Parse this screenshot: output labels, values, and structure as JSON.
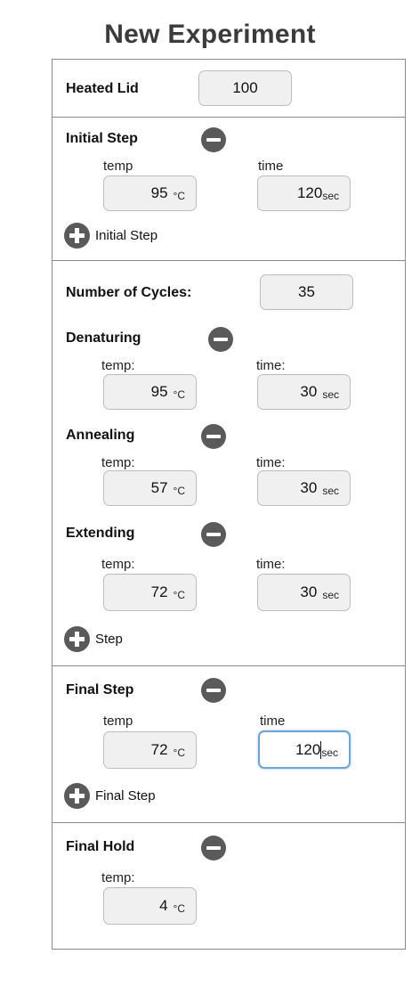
{
  "title": "New Experiment",
  "heated_lid": {
    "label": "Heated Lid",
    "value": "100"
  },
  "initial_step": {
    "label": "Initial Step",
    "temp_label": "temp",
    "time_label": "time",
    "temp": "95",
    "temp_unit": "°C",
    "time": "120",
    "time_unit": "sec",
    "add_label": "Initial Step"
  },
  "cycles": {
    "label": "Number of Cycles:",
    "value": "35",
    "denaturing": {
      "label": "Denaturing",
      "temp_label": "temp:",
      "time_label": "time:",
      "temp": "95",
      "temp_unit": "°C",
      "time": "30",
      "time_unit": "sec"
    },
    "annealing": {
      "label": "Annealing",
      "temp_label": "temp:",
      "time_label": "time:",
      "temp": "57",
      "temp_unit": "°C",
      "time": "30",
      "time_unit": "sec"
    },
    "extending": {
      "label": "Extending",
      "temp_label": "temp:",
      "time_label": "time:",
      "temp": "72",
      "temp_unit": "°C",
      "time": "30",
      "time_unit": "sec"
    },
    "add_label": "Step"
  },
  "final_step": {
    "label": "Final Step",
    "temp_label": "temp",
    "time_label": "time",
    "temp": "72",
    "temp_unit": "°C",
    "time": "120",
    "time_unit": "sec",
    "add_label": "Final Step"
  },
  "final_hold": {
    "label": "Final Hold",
    "temp_label": "temp:",
    "temp": "4",
    "temp_unit": "°C"
  },
  "icons": {
    "remove": "minus-circle-icon",
    "add": "plus-circle-icon"
  }
}
